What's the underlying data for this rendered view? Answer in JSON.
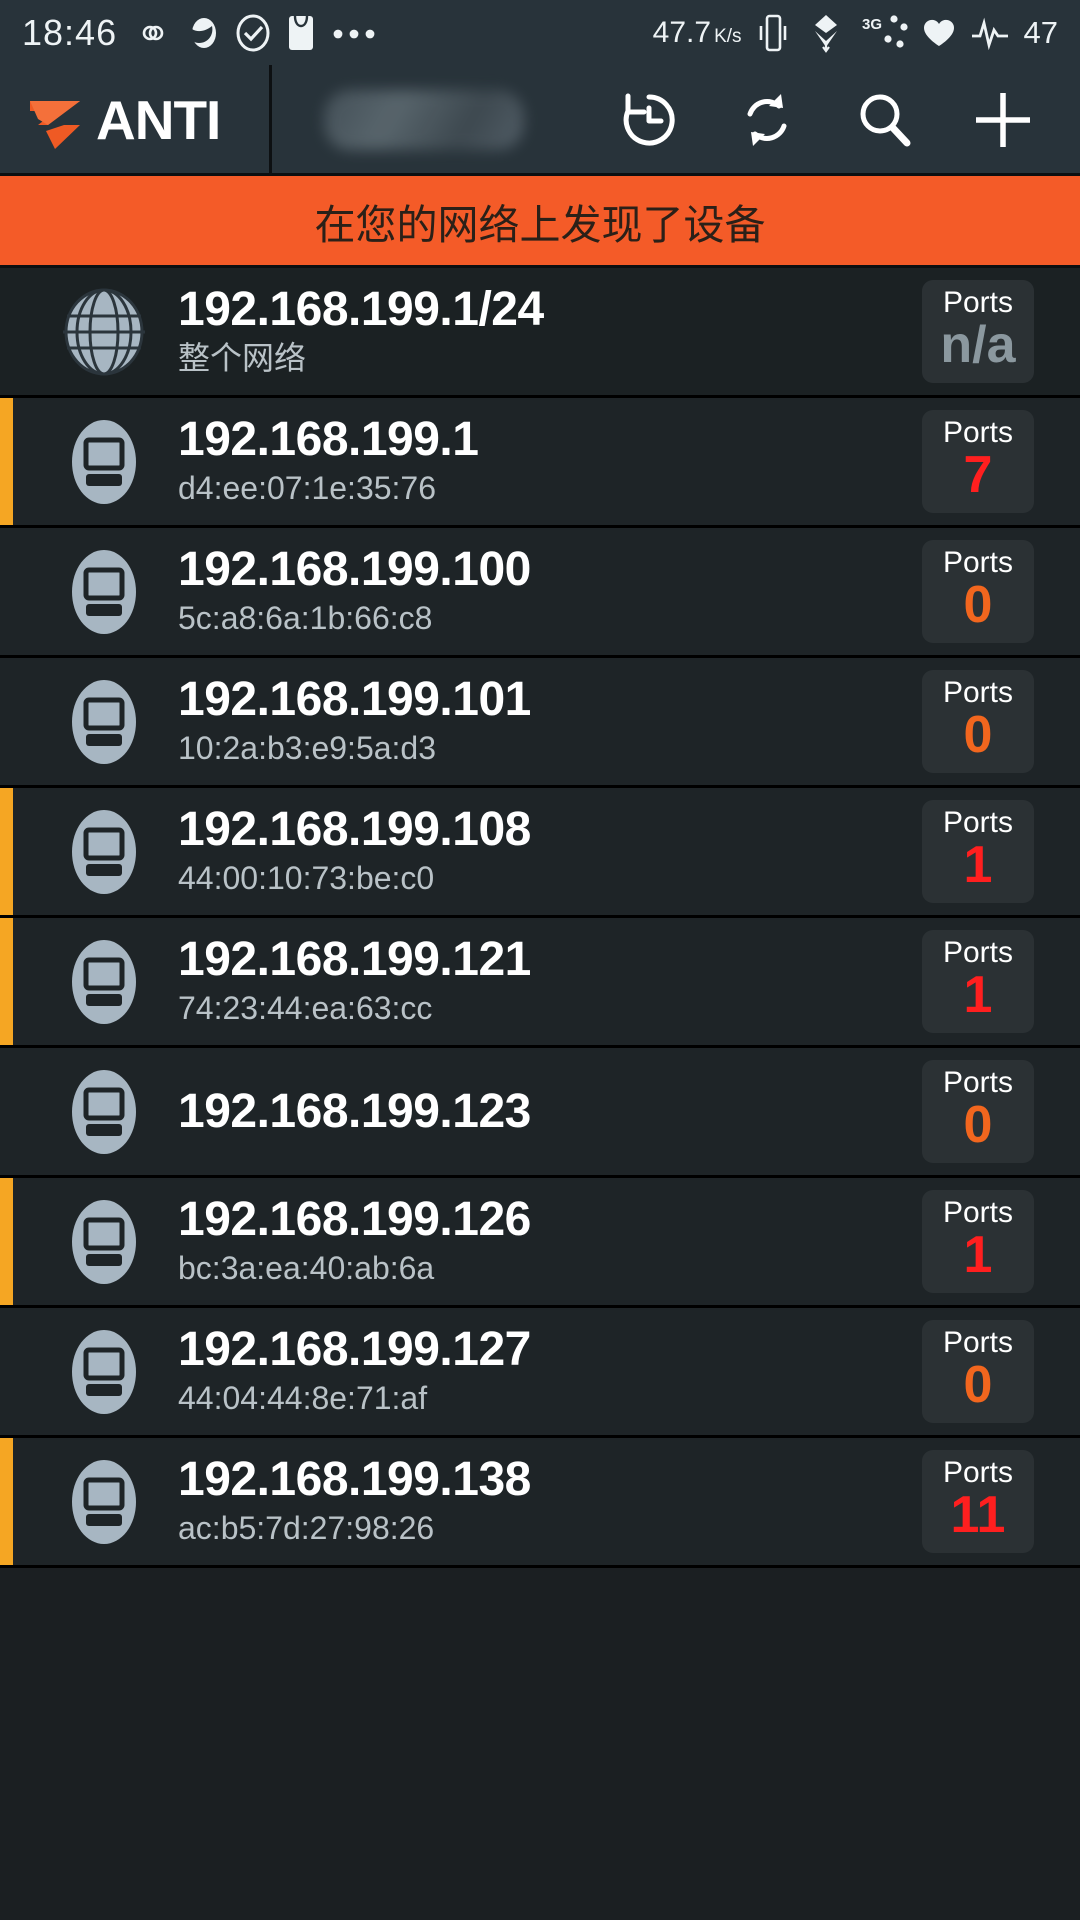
{
  "status_bar": {
    "clock": "18:46",
    "left_icons": [
      "infinity-icon",
      "moon-icon",
      "check-circle-icon",
      "mail-icon",
      "more-dots-icon"
    ],
    "net_speed": "47.7",
    "net_speed_unit": "K/s",
    "right_icons": [
      "vibrate-icon",
      "download-icon",
      "3g-signal-icon",
      "heart-icon",
      "pulse-icon"
    ],
    "battery": "47"
  },
  "app_bar": {
    "brand": "ANTI",
    "brand_mark": "z-logo-icon",
    "network_name_redacted": "",
    "actions": [
      {
        "name": "history-icon",
        "label": "History"
      },
      {
        "name": "refresh-icon",
        "label": "Refresh"
      },
      {
        "name": "search-icon",
        "label": "Search"
      },
      {
        "name": "plus-icon",
        "label": "Add"
      }
    ]
  },
  "banner": {
    "text": "在您的网络上发现了设备"
  },
  "ports_label": "Ports",
  "colors": {
    "accent_orange": "#f45b28",
    "marker_orange": "#f5a623",
    "port_red": "#ff1f1f",
    "port_orange": "#f2661e",
    "port_na": "#8b989f",
    "row_bg": "#1e2427",
    "app_bar_bg": "#28333a"
  },
  "devices": [
    {
      "ip": "192.168.199.1/24",
      "sub": "整个网络",
      "ports": "n/a",
      "port_color": "#8b989f",
      "marker": false,
      "icon": "globe-icon"
    },
    {
      "ip": "192.168.199.1",
      "sub": "d4:ee:07:1e:35:76",
      "ports": "7",
      "port_color": "#ff1f1f",
      "marker": true,
      "icon": "device-icon"
    },
    {
      "ip": "192.168.199.100",
      "sub": "5c:a8:6a:1b:66:c8",
      "ports": "0",
      "port_color": "#f2661e",
      "marker": false,
      "icon": "device-icon"
    },
    {
      "ip": "192.168.199.101",
      "sub": "10:2a:b3:e9:5a:d3",
      "ports": "0",
      "port_color": "#f2661e",
      "marker": false,
      "icon": "device-icon"
    },
    {
      "ip": "192.168.199.108",
      "sub": "44:00:10:73:be:c0",
      "ports": "1",
      "port_color": "#ff1f1f",
      "marker": true,
      "icon": "device-icon"
    },
    {
      "ip": "192.168.199.121",
      "sub": "74:23:44:ea:63:cc",
      "ports": "1",
      "port_color": "#ff1f1f",
      "marker": true,
      "icon": "device-icon"
    },
    {
      "ip": "192.168.199.123",
      "sub": "",
      "ports": "0",
      "port_color": "#f2661e",
      "marker": false,
      "icon": "device-icon"
    },
    {
      "ip": "192.168.199.126",
      "sub": "bc:3a:ea:40:ab:6a",
      "ports": "1",
      "port_color": "#ff1f1f",
      "marker": true,
      "icon": "device-icon"
    },
    {
      "ip": "192.168.199.127",
      "sub": "44:04:44:8e:71:af",
      "ports": "0",
      "port_color": "#f2661e",
      "marker": false,
      "icon": "device-icon"
    },
    {
      "ip": "192.168.199.138",
      "sub": "ac:b5:7d:27:98:26",
      "ports": "11",
      "port_color": "#ff1f1f",
      "marker": true,
      "icon": "device-icon"
    }
  ]
}
